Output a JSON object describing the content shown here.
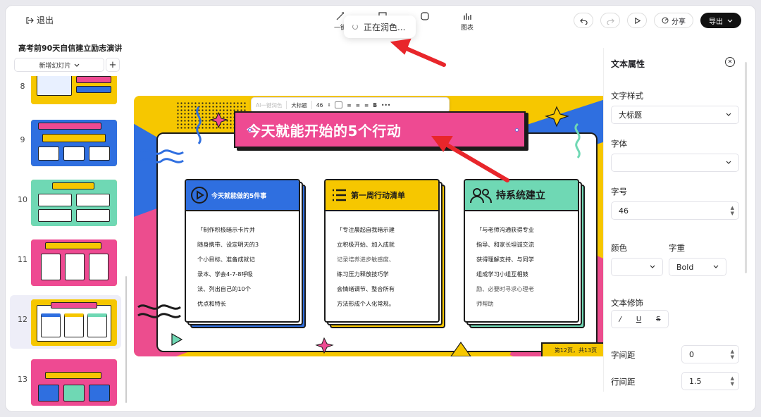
{
  "header": {
    "exit_label": "退出",
    "tools": [
      {
        "label": "一键",
        "icon": "magic-wand-icon"
      },
      {
        "label": "",
        "icon": "layout-icon"
      },
      {
        "label": "",
        "icon": "shape-icon"
      },
      {
        "label": "图表",
        "icon": "chart-icon"
      }
    ],
    "toast": "正在润色...",
    "share_label": "分享",
    "export_label": "导出"
  },
  "sidebar": {
    "doc_title": "高考前90天自信建立励志演讲",
    "add_slide_label": "新增幻灯片",
    "slides": [
      {
        "num": "8",
        "active": false
      },
      {
        "num": "9",
        "active": false
      },
      {
        "num": "10",
        "active": false
      },
      {
        "num": "11",
        "active": false
      },
      {
        "num": "12",
        "active": true
      },
      {
        "num": "13",
        "active": false
      }
    ]
  },
  "toolbar": {
    "ai_label": "AI一键润色",
    "style": "大标题",
    "size": "46",
    "bold": "B",
    "more": "•••"
  },
  "slide": {
    "title": "今天就能开始的5个行动",
    "cards": [
      {
        "header": "今天就能做的5件事",
        "header_color": "#2f6fe0",
        "header_text_color": "#ffffff",
        "shadow_color": "#2f6fe0",
        "lines": [
          "「制作积极暗示卡片并",
          "随身携带、设定明天的3",
          "个小目标、准备成就记",
          "录本、学会4-7-8呼吸",
          "法、列出自己的10个",
          "优点和特长"
        ]
      },
      {
        "header": "第一周行动清单",
        "header_color": "#f6c700",
        "header_text_color": "#1b1b1b",
        "shadow_color": "#f6c700",
        "lines": [
          "「专注晨起自我暗示建",
          "立积极开始、加入成就",
          "记录培养进步敏感度、",
          "练习压力释放技巧学",
          "会情绪调节、整合所有",
          "方法形成个人化常规。"
        ]
      },
      {
        "header": "持系统建立",
        "header_color": "#6fd8b4",
        "header_text_color": "#1b1b1b",
        "shadow_color": "#6fd8b4",
        "lines": [
          "「与老师沟通获得专业",
          "指导、和家长坦诚交流",
          "获得理解支持、与同学",
          "组成学习小组互相鼓",
          "励、必要时寻求心理老",
          "师帮助"
        ]
      }
    ],
    "footer": "第12页，共13页"
  },
  "props": {
    "title": "文本属性",
    "text_style_label": "文字样式",
    "text_style_value": "大标题",
    "font_label": "字体",
    "font_value": "",
    "size_label": "字号",
    "size_value": "46",
    "color_label": "颜色",
    "weight_label": "字重",
    "weight_value": "Bold",
    "deco_label": "文本修饰",
    "deco_italic": "/",
    "deco_underline": "U",
    "deco_strike": "S",
    "spacing_label": "字间距",
    "spacing_value": "0",
    "line_height_label": "行间距",
    "line_height_value": "1.5"
  },
  "colors": {
    "accent_pink": "#ee4a92",
    "accent_yellow": "#f6c700",
    "accent_blue": "#2f6fe0",
    "arrow_red": "#e8262b"
  }
}
